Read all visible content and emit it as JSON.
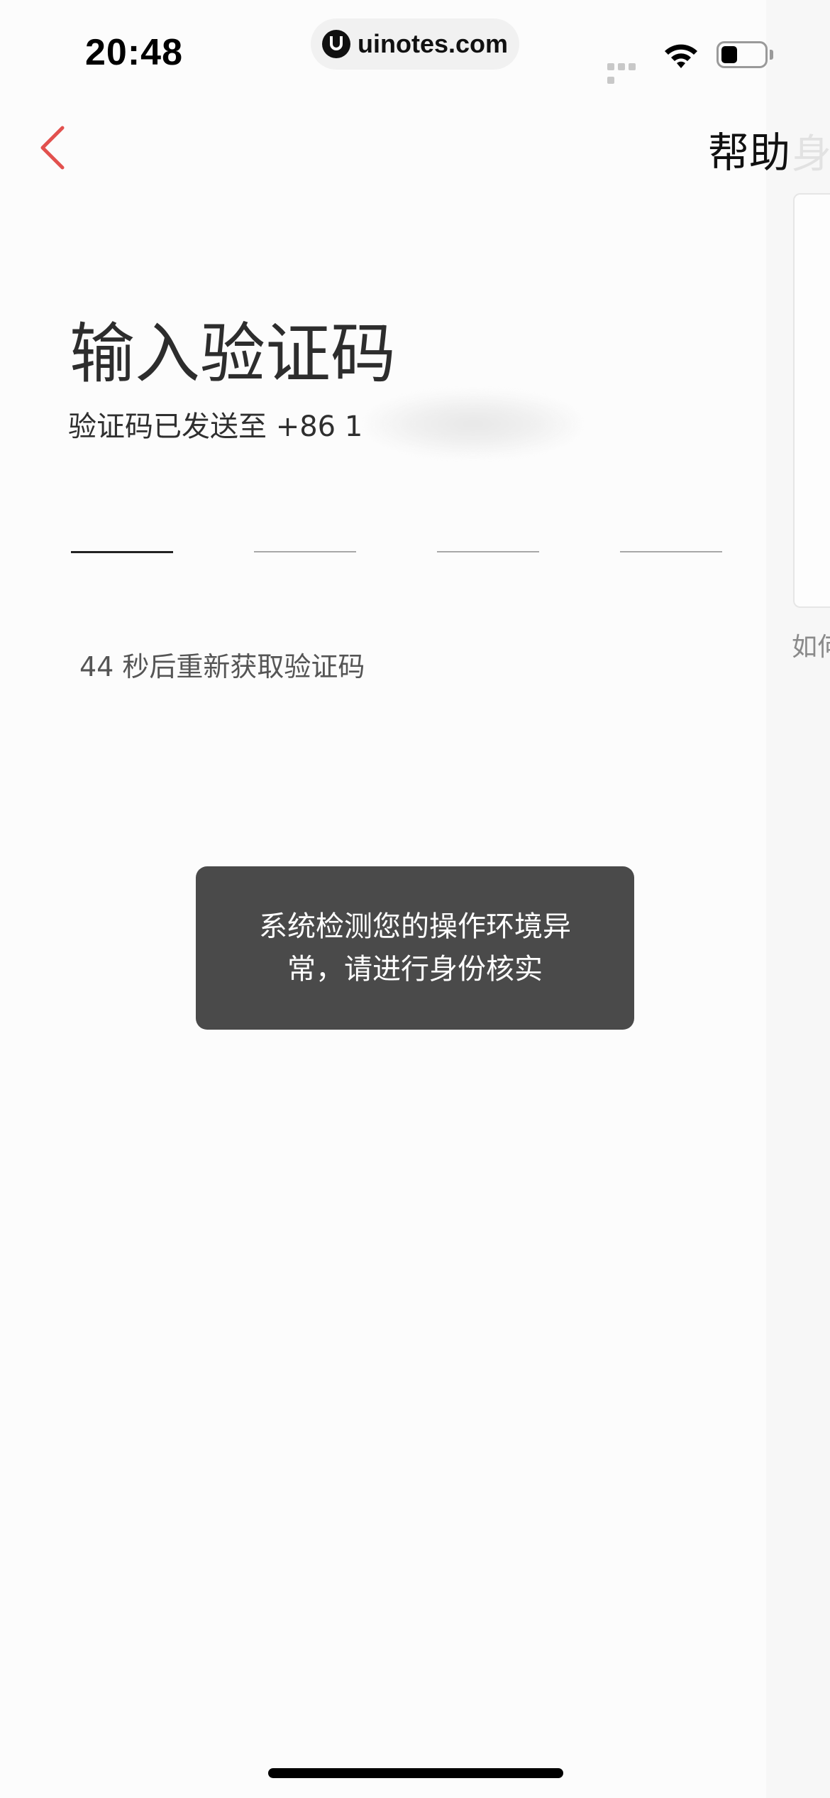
{
  "status_bar": {
    "time": "20:48",
    "url": "uinotes.com",
    "icons": [
      "signal-icon",
      "wifi-icon",
      "battery-icon"
    ]
  },
  "nav": {
    "back_icon": "chevron-left-icon",
    "help_label": "帮助",
    "help_ghost": "身份"
  },
  "side_panel": {
    "text": "如何"
  },
  "main": {
    "title": "输入验证码",
    "sent_to": "验证码已发送至 +86 1",
    "code_slots": 4,
    "countdown": "44 秒后重新获取验证码"
  },
  "toast": {
    "line1": "系统检测您的操作环境异",
    "line2": "常，请进行身份核实"
  },
  "colors": {
    "accent": "#e2514e",
    "toast_bg": "#4a4a4a",
    "background": "#fcfcfc"
  }
}
